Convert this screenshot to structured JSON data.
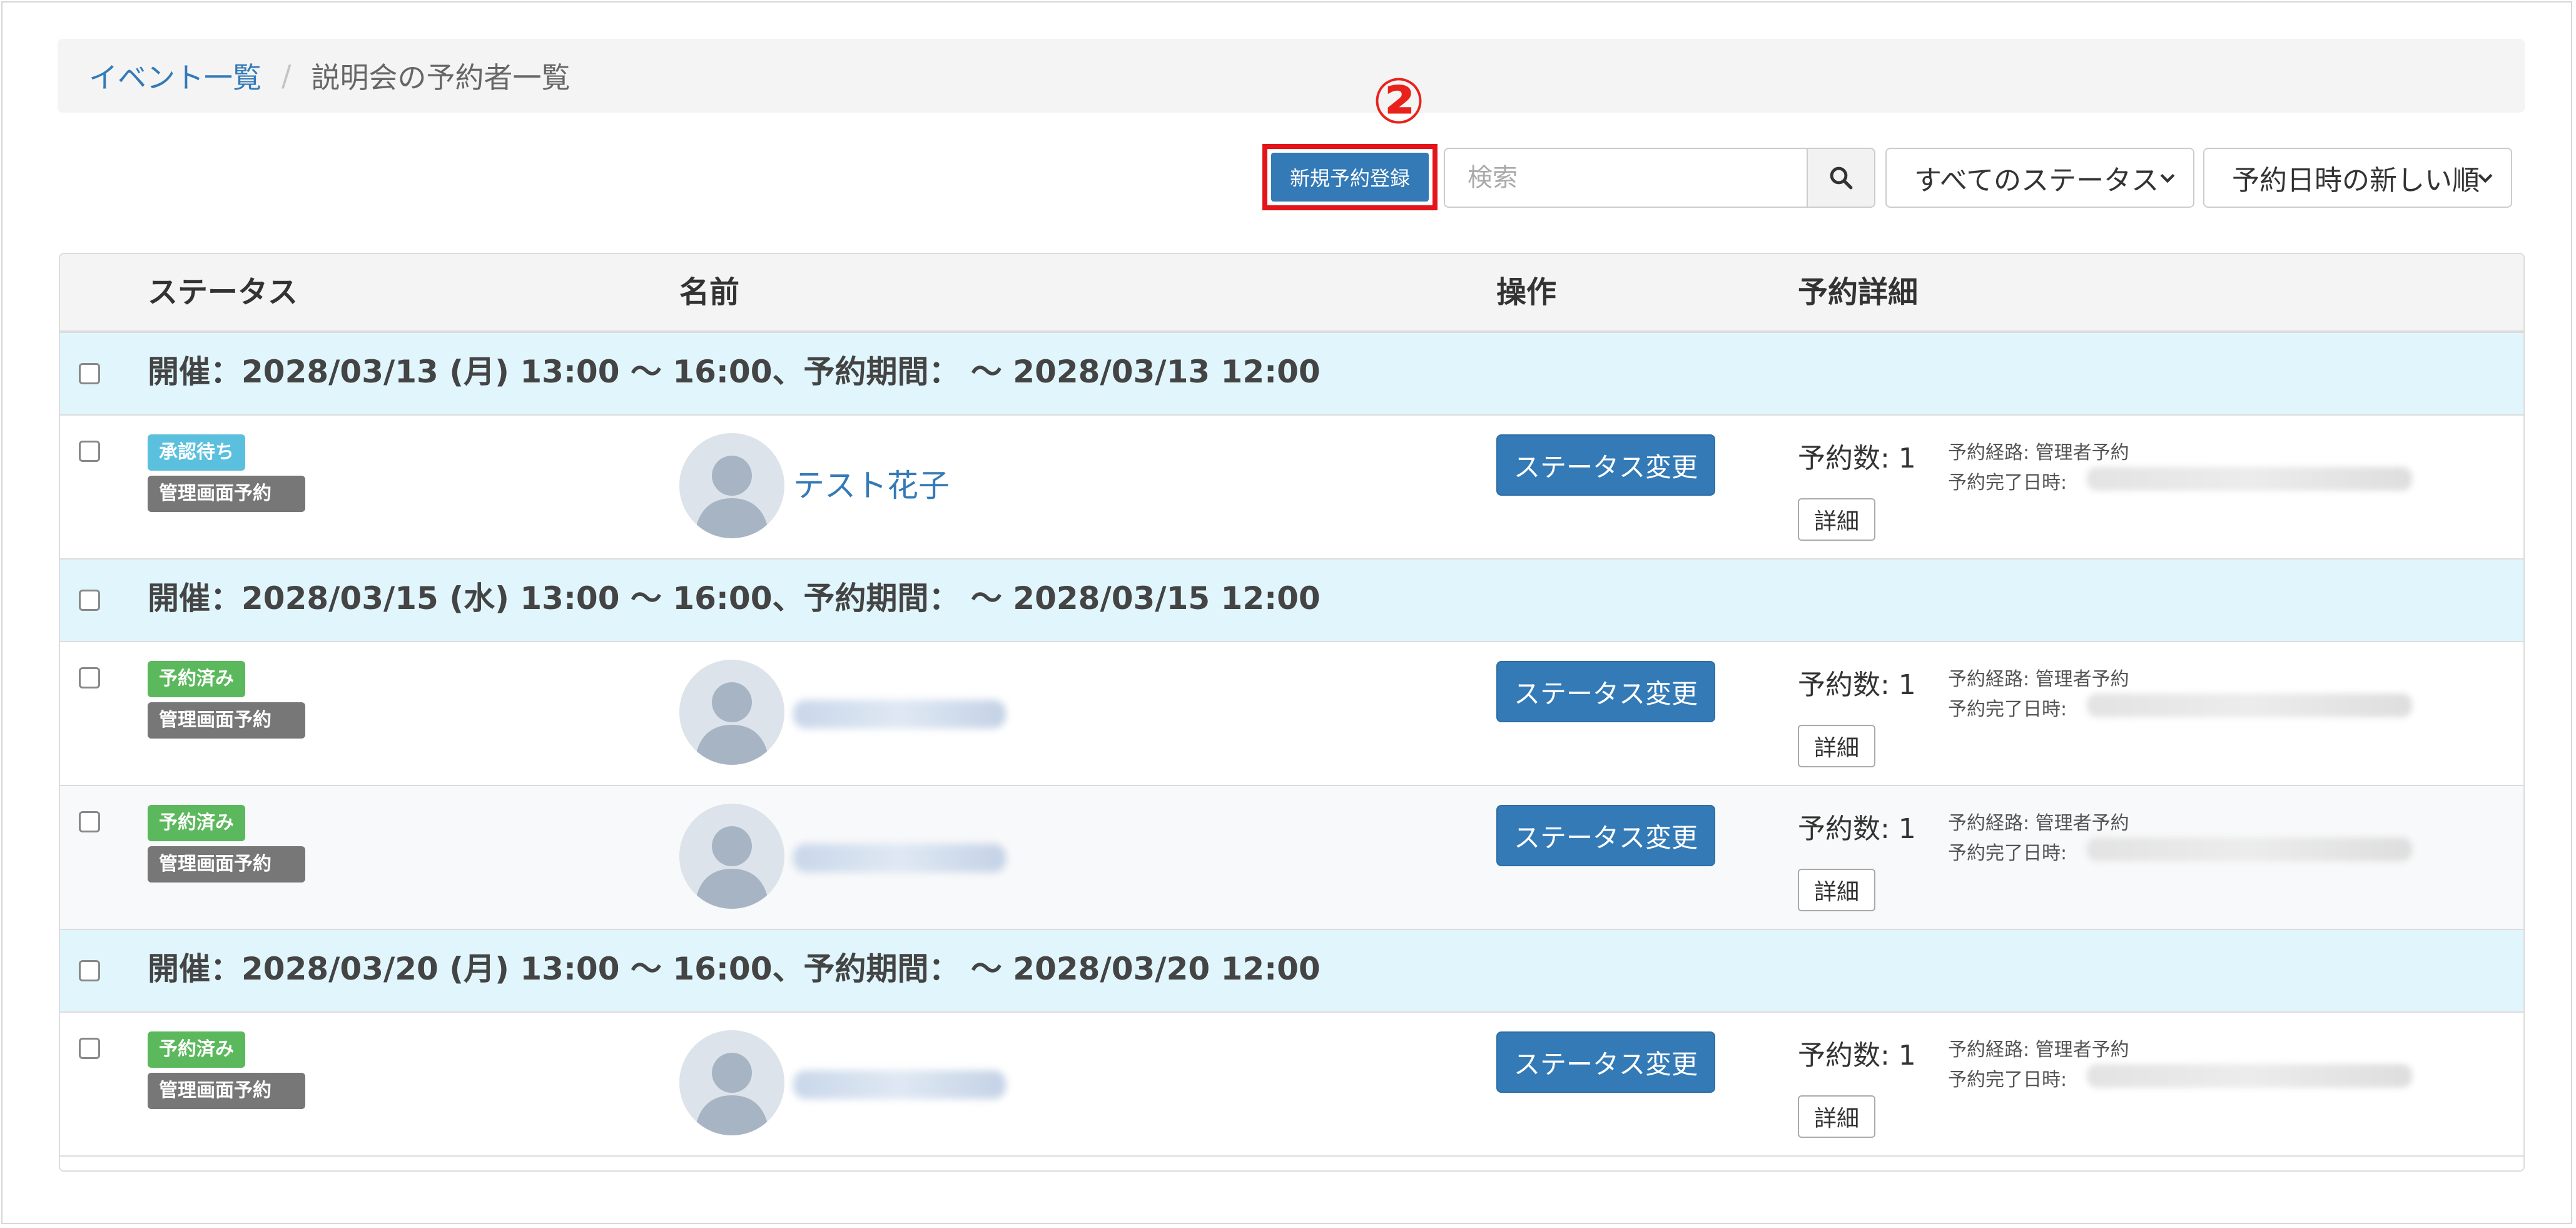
{
  "breadcrumb": {
    "parent": "イベント一覧",
    "separator": "/",
    "current": "説明会の予約者一覧"
  },
  "annotation": {
    "number": "②"
  },
  "toolbar": {
    "new_reservation_label": "新規予約登録",
    "search_placeholder": "検索",
    "status_filter": "すべてのステータス",
    "sort_order": "予約日時の新しい順"
  },
  "table": {
    "headers": {
      "status": "ステータス",
      "name": "名前",
      "action": "操作",
      "details": "予約詳細"
    },
    "status_change_label": "ステータス変更",
    "detail_label": "詳細",
    "count_label": "予約数: 1",
    "route_label": "予約経路: 管理者予約",
    "completed_label": "予約完了日時:",
    "route_badge": "管理画面予約",
    "groups": [
      {
        "header": "開催：2028/03/13 (月) 13:00 ～ 16:00、予約期間： ～ 2028/03/13 12:00",
        "rows": [
          {
            "status": "承認待ち",
            "name": "テスト花子"
          }
        ]
      },
      {
        "header": "開催：2028/03/15 (水) 13:00 ～ 16:00、予約期間： ～ 2028/03/15 12:00",
        "rows": [
          {
            "status": "予約済み",
            "name": ""
          },
          {
            "status": "予約済み",
            "name": ""
          }
        ]
      },
      {
        "header": "開催：2028/03/20 (月) 13:00 ～ 16:00、予約期間： ～ 2028/03/20 12:00",
        "rows": [
          {
            "status": "予約済み",
            "name": ""
          }
        ]
      }
    ]
  },
  "colors": {
    "primary": "#337ab7",
    "pending": "#5bc0de",
    "reserved": "#5cb85c",
    "route_badge": "#777777",
    "group_row": "#e1f6fc",
    "highlight": "#e3141a"
  }
}
